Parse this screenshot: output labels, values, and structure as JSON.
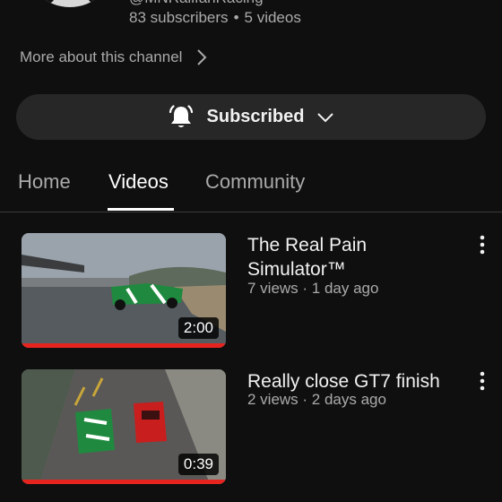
{
  "channel": {
    "handle": "@MNRailfanRacing",
    "subscribers": "83 subscribers",
    "separator": "•",
    "videos_count": "5 videos",
    "more_about": "More about this channel"
  },
  "subscribe_button": {
    "label": "Subscribed",
    "icon": "bell-icon",
    "dropdown_icon": "chevron-down-icon"
  },
  "tabs": [
    {
      "label": "Home",
      "active": false
    },
    {
      "label": "Videos",
      "active": true
    },
    {
      "label": "Community",
      "active": false
    }
  ],
  "videos": [
    {
      "title_line1": "The Real Pain",
      "title_line2": "Simulator™",
      "meta": "7 views · 1 day ago",
      "duration": "2:00",
      "watched_progress": 1.0
    },
    {
      "title_line1": "Really close GT7 finish",
      "meta": "2 views · 2 days ago",
      "duration": "0:39",
      "watched_progress": 1.0
    }
  ],
  "colors": {
    "background": "#0f0f0f",
    "button_bg": "#272727",
    "progress_red": "#e52420",
    "secondary_text": "#aaaaaa"
  }
}
